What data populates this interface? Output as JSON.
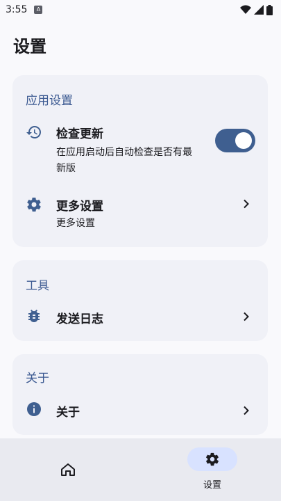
{
  "status_bar": {
    "time": "3:55",
    "notif_badge": "A"
  },
  "page_title": "设置",
  "sections": {
    "app": {
      "title": "应用设置",
      "check_update": {
        "title": "检查更新",
        "subtitle_line1": "在应用启动后自动检查是否有最",
        "subtitle_line2": "新版",
        "enabled": true
      },
      "more_settings": {
        "title": "更多设置",
        "subtitle": "更多设置"
      }
    },
    "tools": {
      "title": "工具",
      "send_log": {
        "title": "发送日志"
      }
    },
    "about": {
      "title": "关于",
      "about_item": {
        "title": "关于"
      }
    }
  },
  "bottom_nav": {
    "settings_label": "设置",
    "selected": "settings"
  },
  "colors": {
    "accent": "#3c5a92",
    "toggle_on": "#3f5f90",
    "card_bg": "#f0f1f7",
    "nav_pill": "#d8e2ff"
  }
}
